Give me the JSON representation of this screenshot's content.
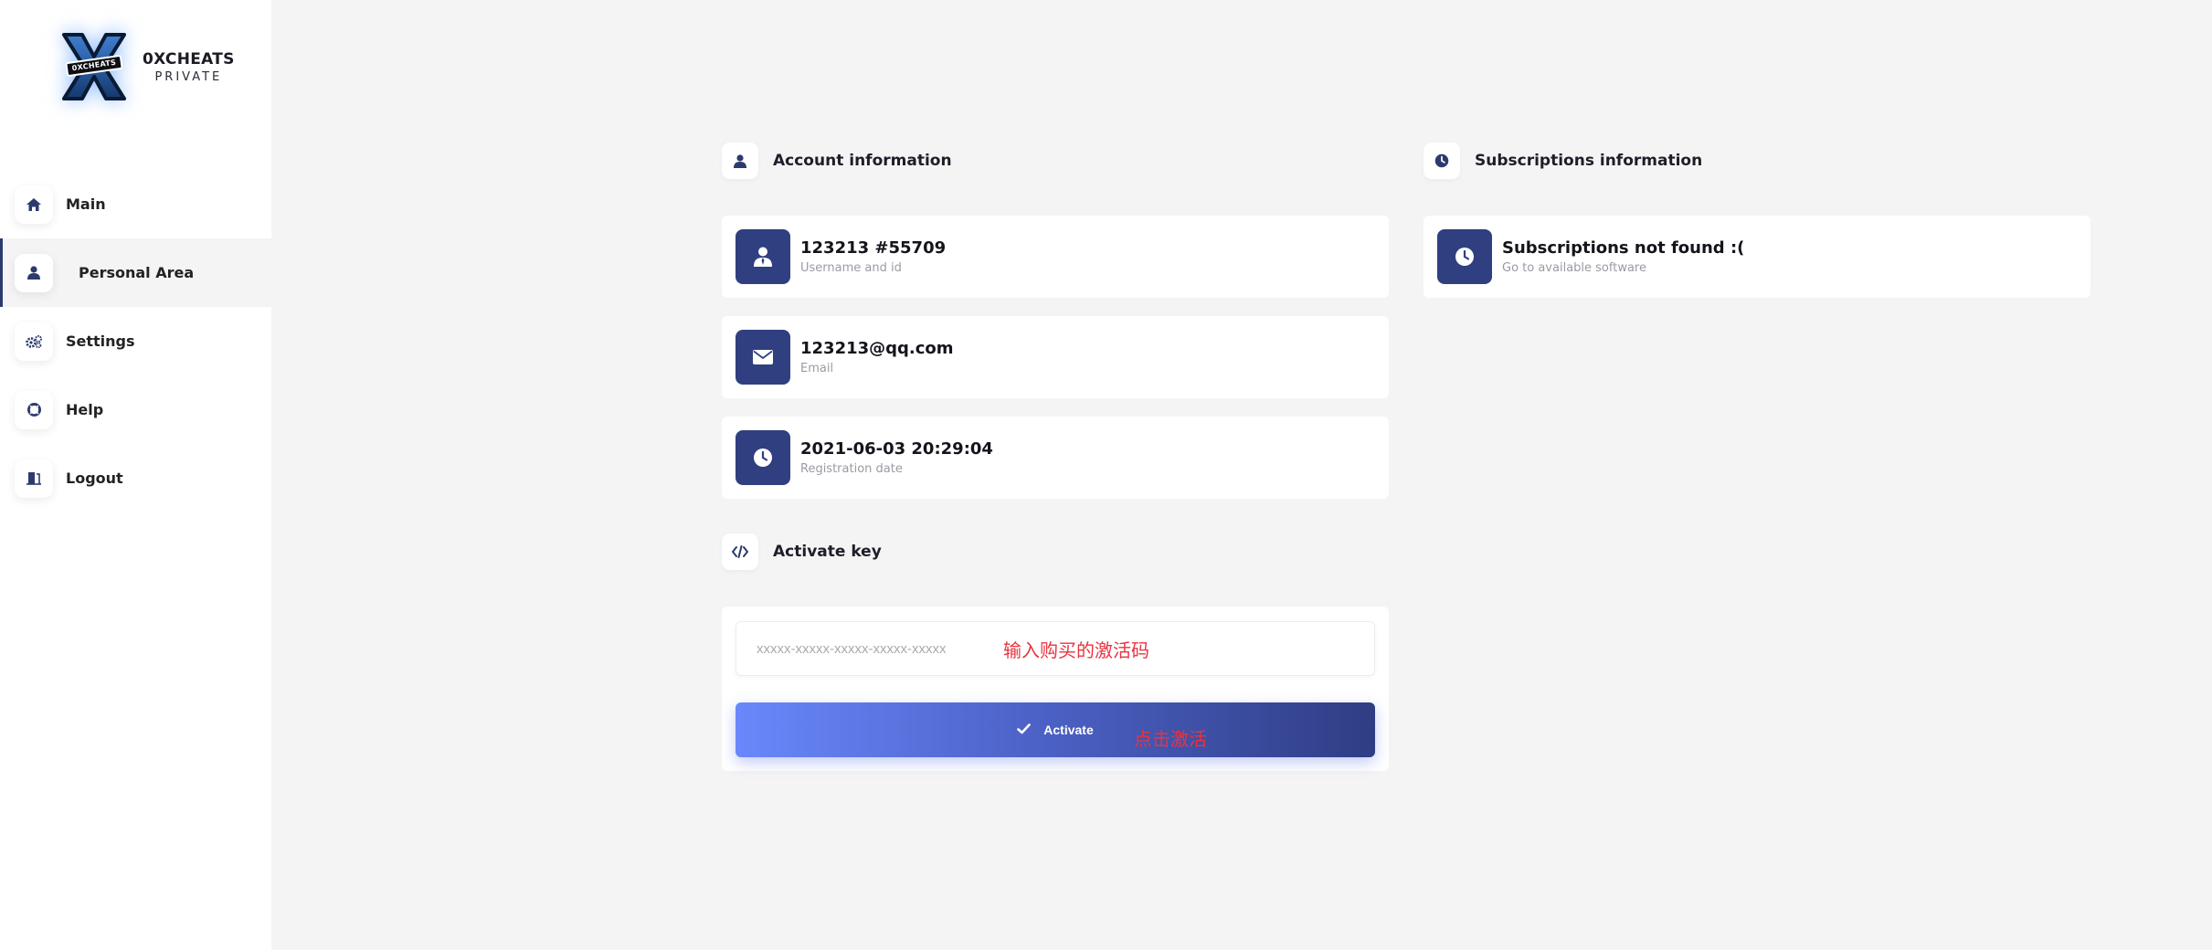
{
  "brand": {
    "title": "0XCHEATS",
    "subtitle": "PRIVATE",
    "logo_badge": "0XCHEATS"
  },
  "nav": {
    "items": [
      {
        "label": "Main",
        "icon": "home-icon",
        "active": false
      },
      {
        "label": "Personal Area",
        "icon": "user-icon",
        "active": true
      },
      {
        "label": "Settings",
        "icon": "gears-icon",
        "active": false
      },
      {
        "label": "Help",
        "icon": "lifebuoy-icon",
        "active": false
      },
      {
        "label": "Logout",
        "icon": "door-exit-icon",
        "active": false
      }
    ]
  },
  "account": {
    "title": "Account information",
    "username": {
      "value": "123213 #55709",
      "label": "Username and id"
    },
    "email": {
      "value": "123213@qq.com",
      "label": "Email"
    },
    "registration": {
      "value": "2021-06-03 20:29:04",
      "label": "Registration date"
    }
  },
  "subscriptions": {
    "title": "Subscriptions information",
    "status": "Subscriptions not found :(",
    "link": "Go to available software"
  },
  "activate": {
    "title": "Activate key",
    "placeholder": "xxxxx-xxxxx-xxxxx-xxxxx-xxxxx",
    "input_hint": "输入购买的激活码",
    "button_label": "Activate",
    "button_hint": "点击激活"
  },
  "colors": {
    "accent": "#2f3f80",
    "hint_red": "#e8333f",
    "background": "#f4f4f4"
  }
}
